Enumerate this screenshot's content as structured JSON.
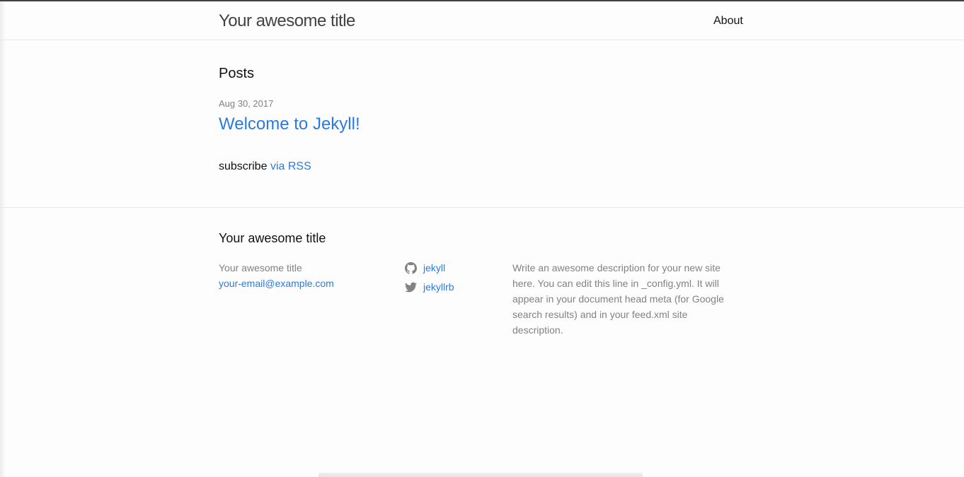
{
  "header": {
    "site_title": "Your awesome title",
    "nav": [
      {
        "label": "About"
      }
    ]
  },
  "main": {
    "heading": "Posts",
    "posts": [
      {
        "date": "Aug 30, 2017",
        "title": "Welcome to Jekyll!"
      }
    ],
    "subscribe_text": "subscribe",
    "rss_link": "via RSS"
  },
  "footer": {
    "heading": "Your awesome title",
    "name": "Your awesome title",
    "email": "your-email@example.com",
    "social": [
      {
        "icon": "github-icon",
        "label": "jekyll"
      },
      {
        "icon": "twitter-icon",
        "label": "jekyllrb"
      }
    ],
    "description": "Write an awesome description for your new site here. You can edit this line in _config.yml. It will appear in your document head meta (for Google search results) and in your feed.xml site description."
  },
  "colors": {
    "link": "#2a7ae2",
    "text": "#111111",
    "muted": "#828282",
    "header_border": "#424242"
  }
}
